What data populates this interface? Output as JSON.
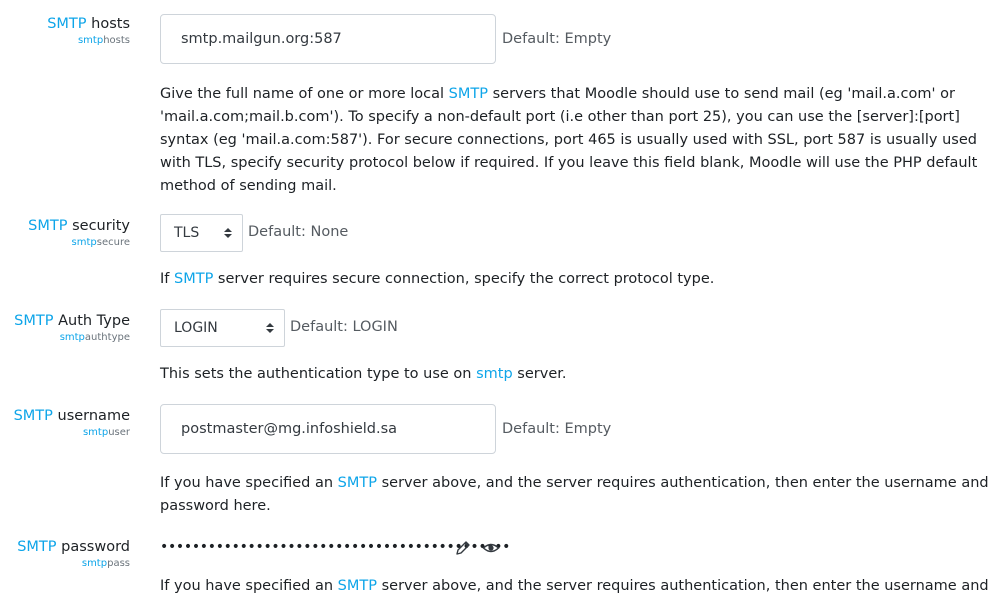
{
  "settings": {
    "hosts": {
      "label_hl": "SMTP",
      "label_rest": " hosts",
      "sub_hl": "smtp",
      "sub_rest": "hosts",
      "value": "smtp.mailgun.org:587",
      "default": "Default: Empty",
      "desc_pre": "Give the full name of one or more local ",
      "desc_hl": "SMTP",
      "desc_post": " servers that Moodle should use to send mail (eg 'mail.a.com' or 'mail.a.com;mail.b.com'). To specify a non-default port (i.e other than port 25), you can use the [server]:[port] syntax (eg 'mail.a.com:587'). For secure connections, port 465 is usually used with SSL, port 587 is usually used with TLS, specify security protocol below if required. If you leave this field blank, Moodle will use the PHP default method of sending mail."
    },
    "security": {
      "label_hl": "SMTP",
      "label_rest": " security",
      "sub_hl": "smtp",
      "sub_rest": "secure",
      "value": "TLS",
      "default": "Default: None",
      "desc_pre": "If ",
      "desc_hl": "SMTP",
      "desc_post": " server requires secure connection, specify the correct protocol type."
    },
    "authtype": {
      "label_hl": "SMTP",
      "label_rest": " Auth Type",
      "sub_hl": "smtp",
      "sub_rest": "authtype",
      "value": "LOGIN",
      "default": "Default: LOGIN",
      "desc_pre": "This sets the authentication type to use on ",
      "desc_hl": "smtp",
      "desc_post": " server."
    },
    "username": {
      "label_hl": "SMTP",
      "label_rest": " username",
      "sub_hl": "smtp",
      "sub_rest": "user",
      "value": "postmaster@mg.infoshield.sa",
      "default": "Default: Empty",
      "desc_pre": "If you have specified an ",
      "desc_hl": "SMTP",
      "desc_post": " server above, and the server requires authentication, then enter the username and password here."
    },
    "password": {
      "label_hl": "SMTP",
      "label_rest": " password",
      "sub_hl": "smtp",
      "sub_rest": "pass",
      "masked": "••••••••••••••••••••••••••••••••••••••••••••",
      "edit_icon": "pencil-icon",
      "reveal_icon": "eye-icon",
      "desc_pre": "If you have specified an ",
      "desc_hl": "SMTP",
      "desc_post": " server above, and the server requires authentication, then enter the username and"
    }
  },
  "colors": {
    "accent": "#0ea5e9",
    "text": "#1d2125",
    "muted": "#6a737b",
    "border": "#ced4da"
  }
}
